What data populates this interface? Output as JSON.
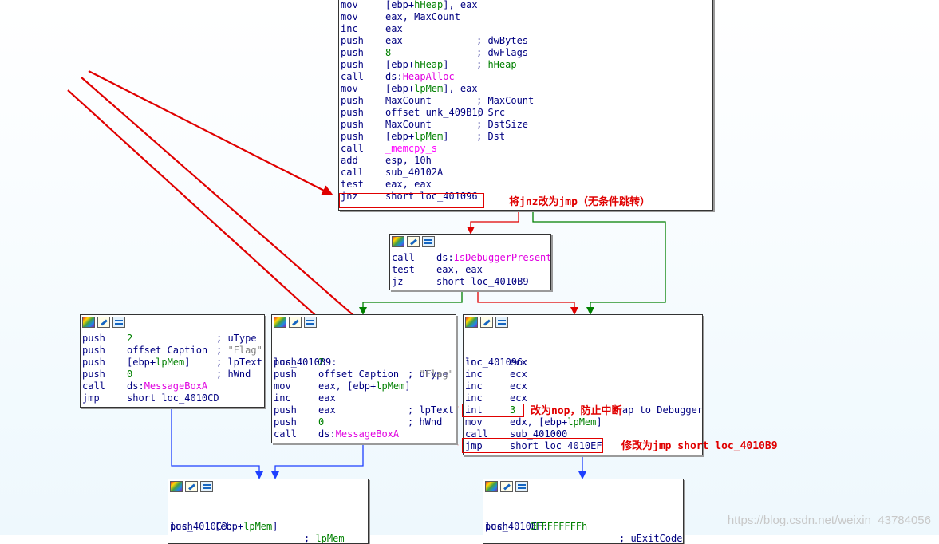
{
  "blocks": {
    "top": {
      "lines": [
        {
          "m": "mov",
          "o": "[ebp+hHeap], eax",
          "c": ""
        },
        {
          "m": "mov",
          "o": "eax, MaxCount",
          "c": ""
        },
        {
          "m": "inc",
          "o": "eax",
          "c": ""
        },
        {
          "m": "push",
          "o": "eax",
          "c": "; dwBytes"
        },
        {
          "m": "push",
          "o": "8",
          "c": "; dwFlags"
        },
        {
          "m": "push",
          "o": "[ebp+hHeap]",
          "c": "; hHeap"
        },
        {
          "m": "call",
          "o": "ds:HeapAlloc",
          "c": ""
        },
        {
          "m": "mov",
          "o": "[ebp+lpMem], eax",
          "c": ""
        },
        {
          "m": "push",
          "o": "MaxCount",
          "c": "; MaxCount"
        },
        {
          "m": "push",
          "o": "offset unk_409B10",
          "c": "; Src"
        },
        {
          "m": "push",
          "o": "MaxCount",
          "c": "; DstSize"
        },
        {
          "m": "push",
          "o": "[ebp+lpMem]",
          "c": "; Dst"
        },
        {
          "m": "call",
          "o": "_memcpy_s",
          "c": ""
        },
        {
          "m": "add",
          "o": "esp, 10h",
          "c": ""
        },
        {
          "m": "call",
          "o": "sub_40102A",
          "c": ""
        },
        {
          "m": "test",
          "o": "eax, eax",
          "c": ""
        },
        {
          "m": "jnz",
          "o": "short loc_401096",
          "c": ""
        }
      ]
    },
    "debugger_check": {
      "lines": [
        {
          "m": "call",
          "o": "ds:IsDebuggerPresent",
          "c": ""
        },
        {
          "m": "test",
          "o": "eax, eax",
          "c": ""
        },
        {
          "m": "jz",
          "o": "short loc_4010B9",
          "c": ""
        }
      ]
    },
    "left": {
      "lines": [
        {
          "m": "push",
          "o": "2",
          "c": "; uType"
        },
        {
          "m": "push",
          "o": "offset Caption",
          "c": "; \"Flag\""
        },
        {
          "m": "push",
          "o": "[ebp+lpMem]",
          "c": "; lpText"
        },
        {
          "m": "push",
          "o": "0",
          "c": "; hWnd"
        },
        {
          "m": "call",
          "o": "ds:MessageBoxA",
          "c": ""
        },
        {
          "m": "jmp",
          "o": "short loc_4010CD",
          "c": ""
        }
      ]
    },
    "middle": {
      "label": "loc_4010B9:",
      "label_comment": "; uType",
      "lines": [
        {
          "m": "push",
          "o": "2",
          "c": ""
        },
        {
          "m": "push",
          "o": "offset Caption",
          "c": "; \"Flag\""
        },
        {
          "m": "mov",
          "o": "eax, [ebp+lpMem]",
          "c": ""
        },
        {
          "m": "inc",
          "o": "eax",
          "c": ""
        },
        {
          "m": "push",
          "o": "eax",
          "c": "; lpText"
        },
        {
          "m": "push",
          "o": "0",
          "c": "; hWnd"
        },
        {
          "m": "call",
          "o": "ds:MessageBoxA",
          "c": ""
        }
      ]
    },
    "right": {
      "label": "loc_401096:",
      "lines": [
        {
          "m": "inc",
          "o": "ecx",
          "c": ""
        },
        {
          "m": "inc",
          "o": "ecx",
          "c": ""
        },
        {
          "m": "inc",
          "o": "ecx",
          "c": ""
        },
        {
          "m": "inc",
          "o": "ecx",
          "c": ""
        },
        {
          "m": "int",
          "o": "3",
          "c": "; Trap to Debugger"
        },
        {
          "m": "mov",
          "o": "edx, [ebp+lpMem]",
          "c": ""
        },
        {
          "m": "call",
          "o": "sub_401000",
          "c": ""
        },
        {
          "m": "jmp",
          "o": "short loc_4010EF",
          "c": ""
        }
      ]
    },
    "bottom_left": {
      "label": "loc_4010CD:",
      "label_comment": "; lpMem",
      "lines": [
        {
          "m": "push",
          "o": "[ebp+lpMem]",
          "c": ""
        }
      ]
    },
    "bottom_right": {
      "label": "loc_4010EF:",
      "label_comment": "; uExitCode",
      "lines": [
        {
          "m": "push",
          "o": "0FFFFFFFFh",
          "c": ""
        }
      ]
    }
  },
  "annotations": {
    "jnz_note": "将jnz改为jmp（无条件跳转）",
    "int3_note": "改为nop，防止中断",
    "jmp_note": "修改为jmp short loc_4010B9"
  },
  "watermark": "https://blog.csdn.net/weixin_43784056",
  "colors": {
    "true_edge": "#008000",
    "false_edge": "#e00000",
    "jump_edge": "#1e40ff",
    "annotation": "#e00000"
  }
}
